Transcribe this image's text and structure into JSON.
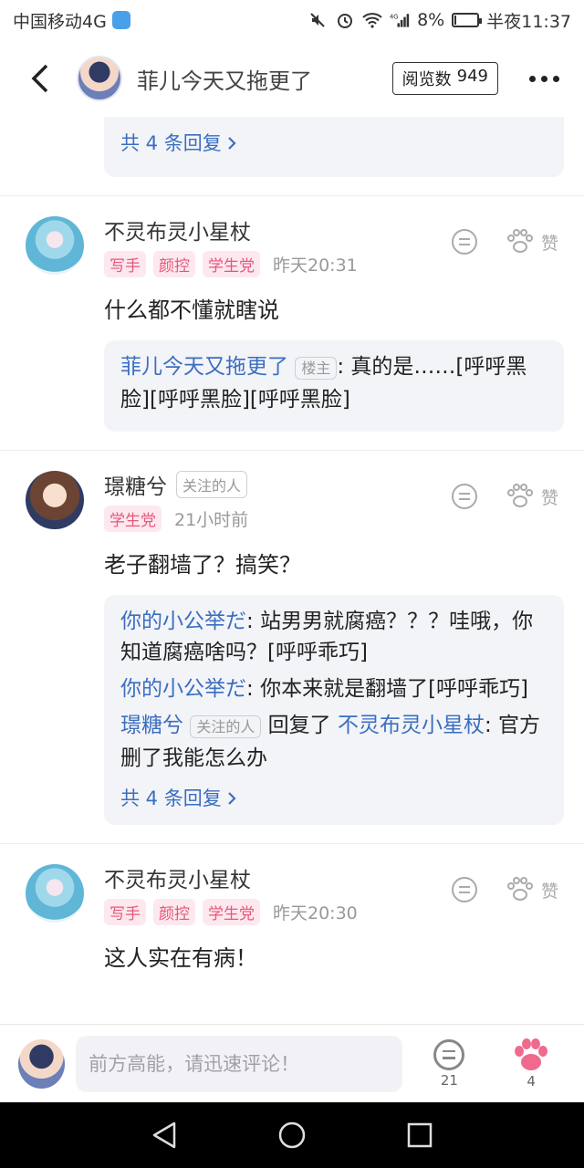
{
  "status_bar": {
    "carrier": "中国移动4G",
    "battery": "8%",
    "battery_level": 0.08,
    "time": "半夜11:37",
    "network": "4G"
  },
  "header": {
    "title": "菲儿今天又拖更了",
    "views_label": "阅览数",
    "views_count": "949"
  },
  "top_fragment": {
    "more_replies": "共 4 条回复"
  },
  "comments": [
    {
      "name": "不灵布灵小星杖",
      "follow_tag": "",
      "tags": [
        "写手",
        "颜控",
        "学生党"
      ],
      "time": "昨天20:31",
      "text": "什么都不懂就瞎说",
      "like_label": "赞",
      "replies": [
        {
          "author": "菲儿今天又拖更了",
          "badge": "楼主",
          "text": "真的是……[呼呼黑脸][呼呼黑脸][呼呼黑脸]"
        }
      ]
    },
    {
      "name": "璟糖兮",
      "follow_tag": "关注的人",
      "tags": [
        "学生党"
      ],
      "time": "21小时前",
      "text": "老子翻墙了？搞笑？",
      "like_label": "赞",
      "replies": [
        {
          "author": "你的小公举だ",
          "text": "站男男就腐癌？？？哇哦，你知道腐癌啥吗？[呼呼乖巧]"
        },
        {
          "author": "你的小公举だ",
          "text": "你本来就是翻墙了[呼呼乖巧]"
        },
        {
          "author": "璟糖兮",
          "badge": "关注的人",
          "action": "回复了",
          "target": "不灵布灵小星杖",
          "text": "官方删了我能怎么办"
        }
      ],
      "more_replies": "共 4 条回复"
    },
    {
      "name": "不灵布灵小星杖",
      "follow_tag": "",
      "tags": [
        "写手",
        "颜控",
        "学生党"
      ],
      "time": "昨天20:30",
      "text": "这人实在有病！",
      "like_label": "赞"
    }
  ],
  "bottom_bar": {
    "placeholder": "前方高能，请迅速评论！",
    "reply_count": "21",
    "like_count": "4"
  },
  "colors": {
    "link": "#3a6ec0",
    "tag_pink_bg": "#fde8ef",
    "tag_pink_text": "#e8567a",
    "paw_pink": "#f06a8e"
  }
}
